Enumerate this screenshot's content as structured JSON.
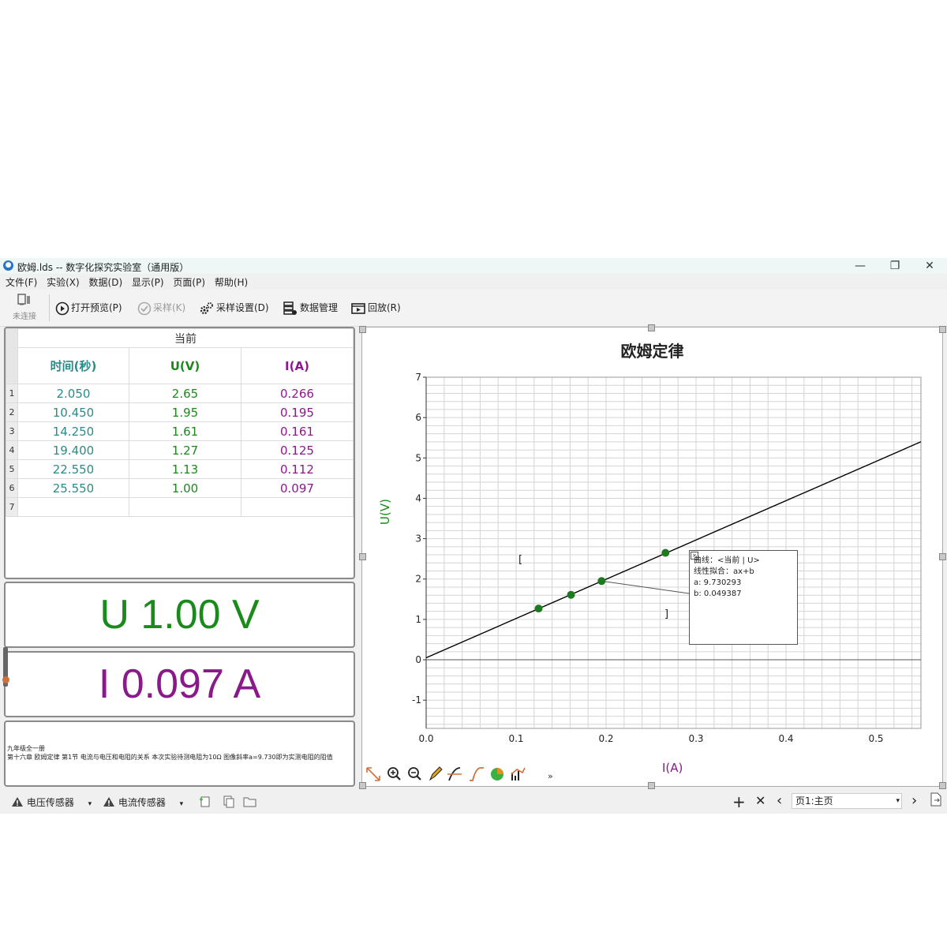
{
  "window": {
    "title": "欧姆.lds -- 数字化探究实验室（通用版）",
    "minimize": "—",
    "maximize": "❐",
    "close": "✕"
  },
  "menu": [
    "文件(F)",
    "实验(X)",
    "数据(D)",
    "显示(P)",
    "页面(P)",
    "帮助(H)"
  ],
  "toolbar": {
    "connection_status": "未连接",
    "open_preview": "打开预览(P)",
    "sample": "采样(K)",
    "sample_settings": "采样设置(D)",
    "data_management": "数据管理",
    "playback": "回放(R)"
  },
  "table": {
    "group_caption": "当前",
    "columns": [
      "时间(秒)",
      "U(V)",
      "I(A)"
    ],
    "column_colors": [
      "#2a8a8a",
      "#1a8a1a",
      "#8a1a8a"
    ],
    "row_numbers": [
      "1",
      "2",
      "3",
      "4",
      "5",
      "6",
      "7"
    ],
    "rows": [
      [
        "2.050",
        "2.65",
        "0.266"
      ],
      [
        "10.450",
        "1.95",
        "0.195"
      ],
      [
        "14.250",
        "1.61",
        "0.161"
      ],
      [
        "19.400",
        "1.27",
        "0.125"
      ],
      [
        "22.550",
        "1.13",
        "0.112"
      ],
      [
        "25.550",
        "1.00",
        "0.097"
      ],
      [
        "",
        "",
        ""
      ]
    ]
  },
  "meters": {
    "voltage": "U 1.00 V",
    "voltage_color": "#1a8a1a",
    "current": "I 0.097 A",
    "current_color": "#8a1a8a"
  },
  "notes": {
    "line1": "九年级全一册",
    "line2": "第十六章 欧姆定律 第1节 电流与电压和电阻的关系      本次实验待测电阻为10Ω   图像斜率a=9.730即为实测电阻的阻值"
  },
  "fit_box": {
    "curve": "曲线：<当前 | U>",
    "fit": "线性拟合：ax+b",
    "a": "a: 9.730293",
    "b": "b: 0.049387"
  },
  "chart_data": {
    "type": "scatter",
    "title": "欧姆定律",
    "xlabel": "I(A)",
    "ylabel": "U(V)",
    "xlim": [
      0,
      0.55
    ],
    "ylim": [
      -1.7,
      7
    ],
    "x_ticks": [
      "0.0",
      "0.1",
      "0.2",
      "0.3",
      "0.4",
      "0.5"
    ],
    "y_ticks": [
      "-1",
      "0",
      "1",
      "2",
      "3",
      "4",
      "5",
      "6",
      "7"
    ],
    "grid": true,
    "series": [
      {
        "x": [
          0.266,
          0.195,
          0.161,
          0.125
        ],
        "y": [
          2.65,
          1.95,
          1.61,
          1.27
        ],
        "color": "#1e7a1e"
      }
    ],
    "fit": {
      "a": 9.730293,
      "b": 0.049387,
      "color": "#000000"
    }
  },
  "statusbar": {
    "sensor1": "电压传感器",
    "sensor2": "电流传感器",
    "page": "页1:主页"
  }
}
